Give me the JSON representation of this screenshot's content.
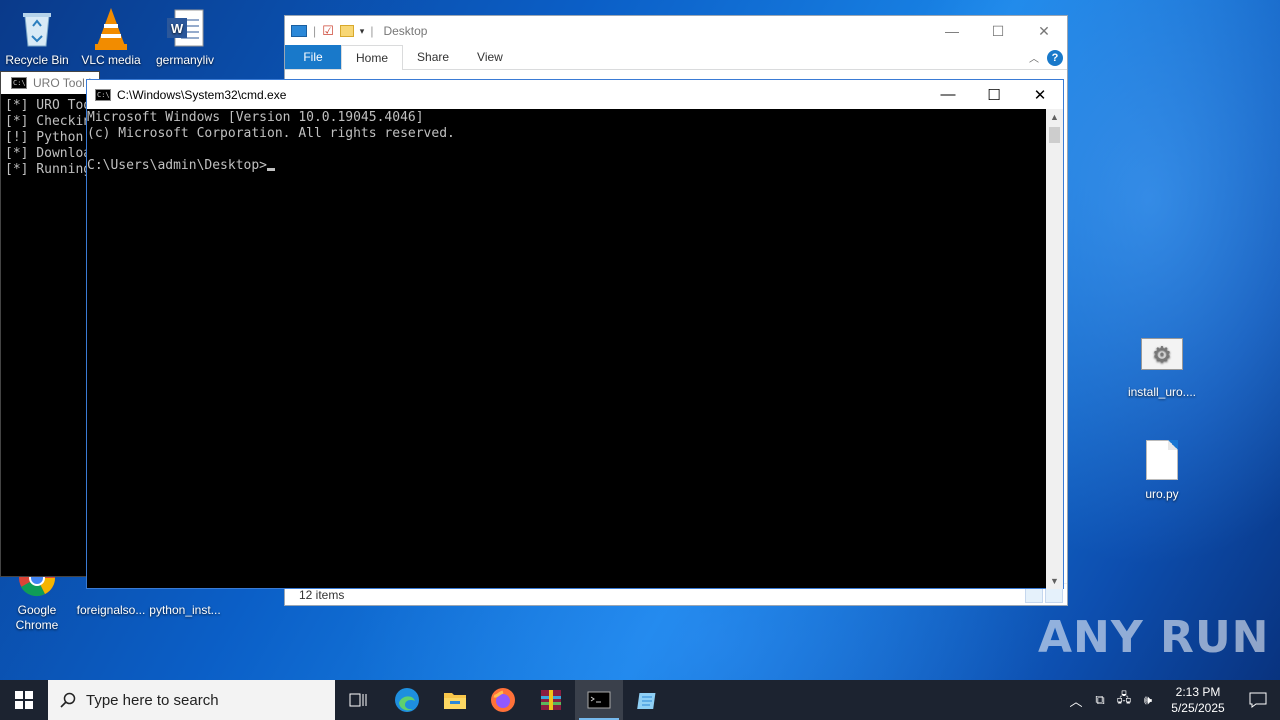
{
  "desktop": {
    "icons_left": [
      {
        "label": "Recycle Bin",
        "icon": "recycle-bin-icon"
      },
      {
        "label": "VLC media",
        "icon": "vlc-icon"
      },
      {
        "label": "germanyliv",
        "icon": "word-doc-icon"
      }
    ],
    "icons_bottom": [
      {
        "label": "Google Chrome",
        "icon": "chrome-icon"
      },
      {
        "label": "foreignalso...",
        "icon": "file-icon"
      },
      {
        "label": "python_inst...",
        "icon": "python-installer-icon"
      }
    ],
    "icons_right": [
      {
        "label": "install_uro....",
        "icon": "batch-file-icon"
      },
      {
        "label": "uro.py",
        "icon": "file-icon"
      }
    ]
  },
  "explorer": {
    "title": "Desktop",
    "tabs": [
      "File",
      "Home",
      "Share",
      "View"
    ],
    "status": "12 items"
  },
  "uro_console": {
    "title": "URO Tool I",
    "lines": [
      "[*] URO Too",
      "[*] Checkin",
      "[!] Python ",
      "[*] Downloa",
      "[*] Running"
    ]
  },
  "cmd": {
    "title": "C:\\Windows\\System32\\cmd.exe",
    "line1": "Microsoft Windows [Version 10.0.19045.4046]",
    "line2": "(c) Microsoft Corporation. All rights reserved.",
    "prompt": "C:\\Users\\admin\\Desktop>"
  },
  "watermark": "ANY RUN",
  "taskbar": {
    "search_placeholder": "Type here to search",
    "time": "2:13 PM",
    "date": "5/25/2025"
  },
  "colors": {
    "accent": "#1979ca",
    "taskbar": "#1c2330",
    "console_text": "#c0c0c0"
  }
}
